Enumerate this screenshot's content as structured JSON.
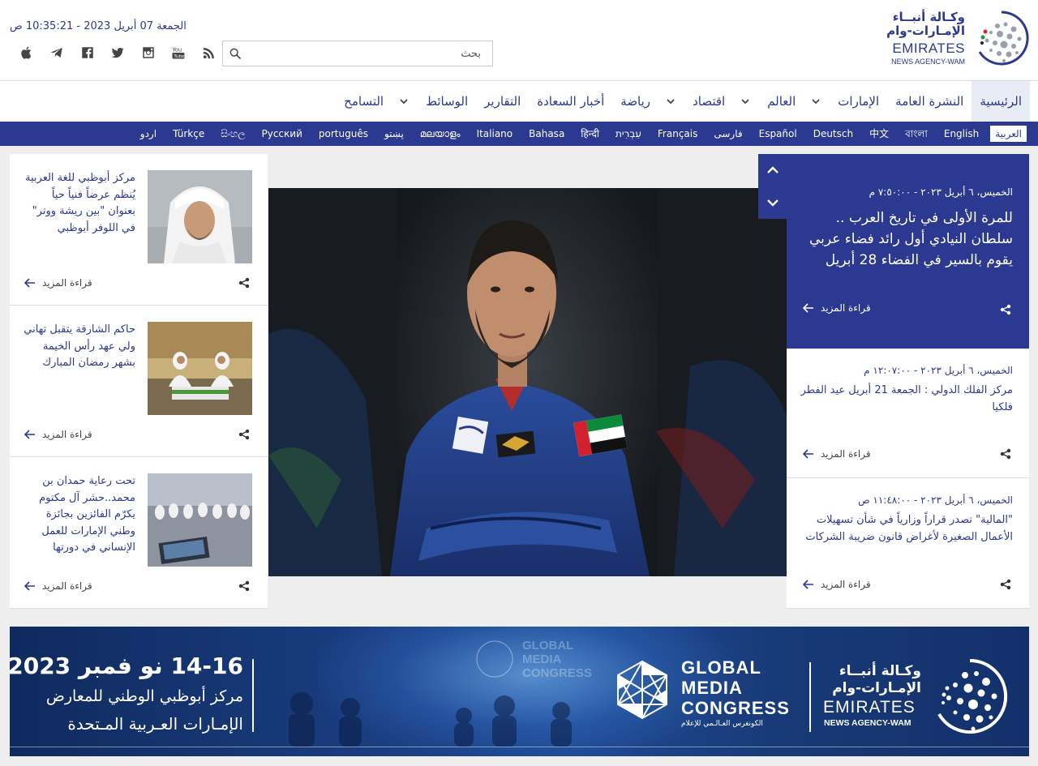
{
  "header": {
    "datetime": "الجمعة 07 أبريل 2023 - 10:35:21 ص",
    "search_placeholder": "بحث",
    "social_icons": [
      "apple-icon",
      "telegram-icon",
      "facebook-icon",
      "twitter-icon",
      "instagram-icon",
      "youtube-icon",
      "rss-icon"
    ],
    "logo": {
      "ar_line1": "وكـالة أنبــاء",
      "ar_line2": "الإمـارات-وام",
      "en_line1": "EMIRATES",
      "en_line2": "NEWS AGENCY-WAM"
    }
  },
  "main_nav": [
    {
      "label": "الرئيسية",
      "dropdown": false,
      "active": true
    },
    {
      "label": "النشرة العامة",
      "dropdown": false
    },
    {
      "label": "الإمارات",
      "dropdown": true
    },
    {
      "label": "العالم",
      "dropdown": true
    },
    {
      "label": "اقتصاد",
      "dropdown": true
    },
    {
      "label": "رياضة",
      "dropdown": false
    },
    {
      "label": "أخبار السعادة",
      "dropdown": false
    },
    {
      "label": "التقارير",
      "dropdown": false
    },
    {
      "label": "الوسائط",
      "dropdown": true
    },
    {
      "label": "التسامح",
      "dropdown": false
    }
  ],
  "languages": [
    "العربية",
    "English",
    "বাংলা",
    "中文",
    "Deutsch",
    "Español",
    "فارسی",
    "Français",
    "עִבְרִית",
    "हिन्दी",
    "Bahasa",
    "Italiano",
    "മലയാളം",
    "پښتو",
    "português",
    "Русский",
    "සිංහල",
    "Türkçe",
    "اردو"
  ],
  "left_cards": [
    {
      "title": "مركز أبوظبي للغة العربية يُنظم عرضاً فنياً حياً بعنوان \"بين ريشة ووتر\" في اللوفر أبوظبي",
      "more": "قراءة المزيد"
    },
    {
      "title": "حاكم الشارقة يتقبل تهاني ولي عهد رأس الخيمة بشهر رمضان المبارك",
      "more": "قراءة المزيد"
    },
    {
      "title": "تحت رعاية حمدان بن محمد..حشر آل مكتوم يكرّم الفائزين بجائزة وطني الإمارات للعمل الإنساني في دورتها",
      "more": "قراءة المزيد"
    }
  ],
  "featured": {
    "date": "الخميس، ٦ أبريل ٢٠٢٣ - ٧:٥٠:٠٠ م",
    "title": "للمرة الأولى في تاريخ العرب .. سلطان النيادي أول رائد فضاء عربي يقوم بالسير في الفضاء 28 أبريل",
    "more": "قراءة المزيد"
  },
  "right_cards": [
    {
      "date": "الخميس، ٦ أبريل ٢٠٢٣ - ١٢:٠٧:٠٠ م",
      "title": "مركز الفلك الدولي : الجمعة 21 أبريل عيد الفطر فلكيا",
      "more": "قراءة المزيد"
    },
    {
      "date": "الخميس، ٦ أبريل ٢٠٢٣ - ١١:٤٨:٠٠ ص",
      "title": "\"المالية\" تصدر قراراً وزارياً في شأن تسهيلات الأعمال الصغيرة لأغراض قانون ضريبة الشركات",
      "more": "قراءة المزيد"
    }
  ],
  "banner": {
    "dates": "14-16 نو فمبر 2023",
    "venue_line1": "مركز أبوظبي الوطني للمعارض",
    "venue_line2": "الإمـارات العـربية المـتحدة",
    "gmc_line1": "GLOBAL",
    "gmc_line2": "MEDIA",
    "gmc_line3": "CONGRESS",
    "gmc_ar": "الكونغرس العـالـمي للإعلام",
    "wam_ar1": "وكـالة أنبــاء",
    "wam_ar2": "الإمـارات-وام",
    "wam_en1": "EMIRATES",
    "wam_en2": "NEWS AGENCY-WAM"
  },
  "colors": {
    "brand": "#2b3990",
    "background": "#eeeeee"
  }
}
